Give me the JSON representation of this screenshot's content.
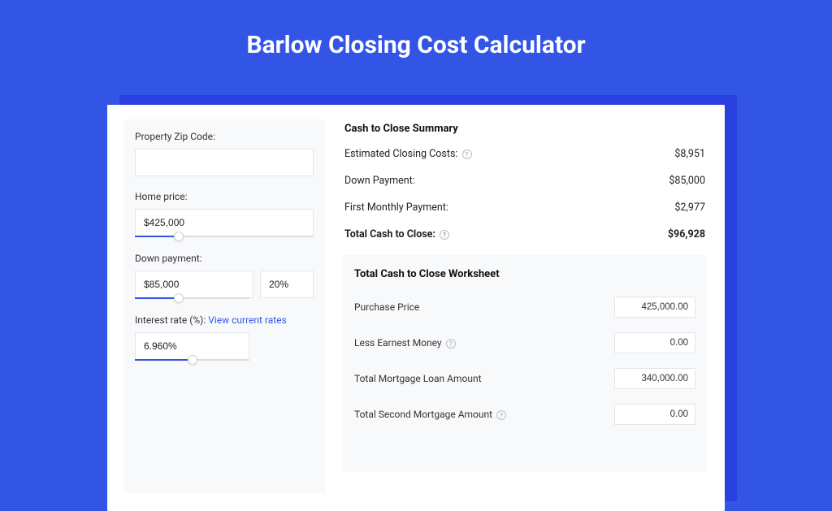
{
  "page": {
    "title": "Barlow Closing Cost Calculator"
  },
  "form": {
    "zip_label": "Property Zip Code:",
    "zip_value": "",
    "home_price_label": "Home price:",
    "home_price_value": "$425,000",
    "down_payment_label": "Down payment:",
    "down_payment_value": "$85,000",
    "down_payment_pct": "20%",
    "interest_label_prefix": "Interest rate (%): ",
    "interest_link": "View current rates",
    "interest_value": "6.960%"
  },
  "summary": {
    "title": "Cash to Close Summary",
    "rows": [
      {
        "label": "Estimated Closing Costs:",
        "info": true,
        "value": "$8,951"
      },
      {
        "label": "Down Payment:",
        "info": false,
        "value": "$85,000"
      },
      {
        "label": "First Monthly Payment:",
        "info": false,
        "value": "$2,977"
      }
    ],
    "total_label": "Total Cash to Close:",
    "total_value": "$96,928"
  },
  "worksheet": {
    "title": "Total Cash to Close Worksheet",
    "rows": [
      {
        "label": "Purchase Price",
        "info": false,
        "value": "425,000.00"
      },
      {
        "label": "Less Earnest Money",
        "info": true,
        "value": "0.00"
      },
      {
        "label": "Total Mortgage Loan Amount",
        "info": false,
        "value": "340,000.00"
      },
      {
        "label": "Total Second Mortgage Amount",
        "info": true,
        "value": "0.00"
      }
    ]
  }
}
